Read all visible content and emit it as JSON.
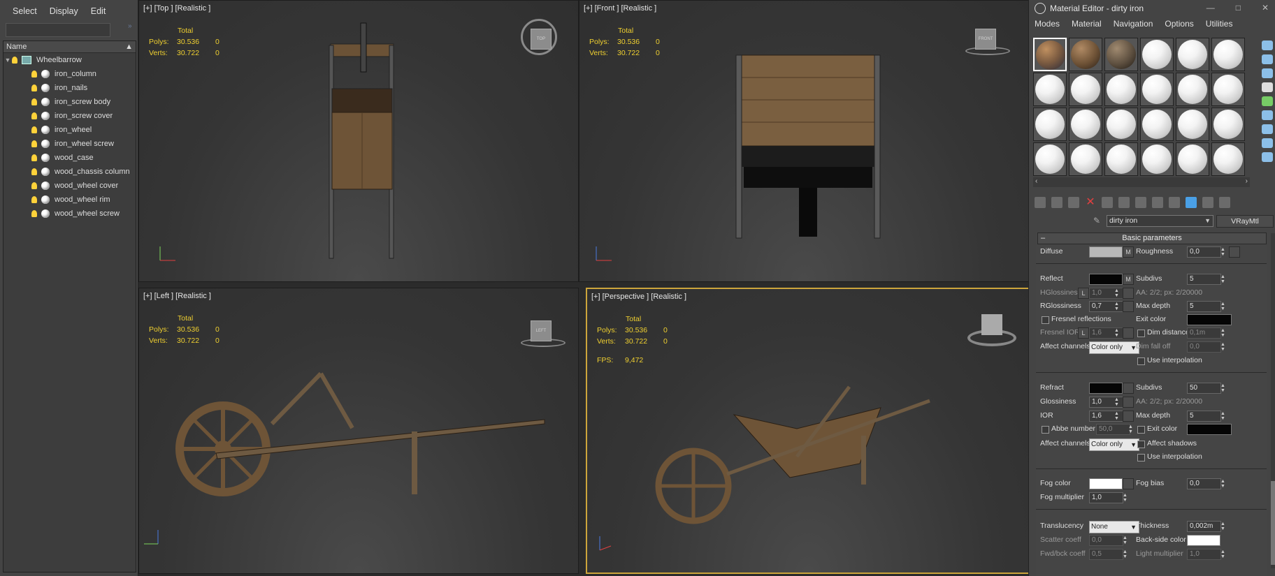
{
  "explorer": {
    "menu": [
      "Select",
      "Display",
      "Edit"
    ],
    "column_header": "Name",
    "root": "Wheelbarrow",
    "items": [
      "iron_column",
      "iron_nails",
      "iron_screw body",
      "iron_screw cover",
      "iron_wheel",
      "iron_wheel screw",
      "wood_case",
      "wood_chassis column",
      "wood_wheel cover",
      "wood_wheel rim",
      "wood_wheel screw"
    ]
  },
  "viewports": {
    "top": {
      "label": "[+] [Top ] [Realistic ]",
      "cube": "TOP"
    },
    "front": {
      "label": "[+] [Front ] [Realistic ]",
      "cube": "FRONT"
    },
    "left": {
      "label": "[+] [Left ] [Realistic ]",
      "cube": "LEFT"
    },
    "persp": {
      "label": "[+] [Perspective ] [Realistic ]",
      "cube": ""
    }
  },
  "stats": {
    "total": "Total",
    "polys_label": "Polys:",
    "polys_total": "30.536",
    "polys_sel": "0",
    "verts_label": "Verts:",
    "verts_total": "30.722",
    "verts_sel": "0",
    "fps_label": "FPS:",
    "fps_value": "9,472"
  },
  "material_editor": {
    "title": "Material Editor - dirty iron",
    "menu": [
      "Modes",
      "Material",
      "Navigation",
      "Options",
      "Utilities"
    ],
    "material_name": "dirty iron",
    "material_type": "VRayMtl",
    "section": "Basic parameters",
    "params": {
      "diffuse": "Diffuse",
      "roughness": "Roughness",
      "roughness_val": "0,0",
      "reflect": "Reflect",
      "subdivs": "Subdivs",
      "reflect_subdivs": "5",
      "hgloss": "HGlossiness",
      "hgloss_val": "1,0",
      "aa_info": "AA: 2/2; px: 2/20000",
      "rgloss": "RGlossiness",
      "rgloss_val": "0,7",
      "max_depth": "Max depth",
      "reflect_max_depth": "5",
      "fresnel": "Fresnel reflections",
      "exit_color": "Exit color",
      "fresnel_ior": "Fresnel IOR",
      "fresnel_ior_val": "1,6",
      "dim_distance": "Dim distance",
      "dim_distance_val": "0,1m",
      "affect_channels": "Affect channels",
      "color_only": "Color only",
      "dim_falloff": "Dim fall off",
      "dim_falloff_val": "0,0",
      "use_interpolation": "Use interpolation",
      "refract": "Refract",
      "refract_subdivs": "50",
      "glossiness": "Glossiness",
      "glossiness_val": "1,0",
      "ior": "IOR",
      "ior_val": "1,6",
      "refract_max_depth": "5",
      "abbe": "Abbe number",
      "abbe_val": "50,0",
      "refract_exit_color": "Exit color",
      "affect_shadows": "Affect shadows",
      "fog_color": "Fog color",
      "fog_bias": "Fog bias",
      "fog_bias_val": "0,0",
      "fog_multiplier": "Fog multiplier",
      "fog_multiplier_val": "1,0",
      "translucency": "Translucency",
      "translucency_val": "None",
      "thickness": "Thickness",
      "thickness_val": "0,002m",
      "scatter": "Scatter coeff",
      "scatter_val": "0,0",
      "backside": "Back-side color",
      "fwdbck": "Fwd/bck coeff",
      "fwdbck_val": "0,5",
      "light_mult": "Light multiplier",
      "light_mult_val": "1,0",
      "m": "M",
      "l": "L"
    }
  },
  "colors": {
    "accent": "#cda53b",
    "stats": "#f0d030",
    "bg": "#2b2b2b",
    "blue": "#4aa0e6"
  }
}
